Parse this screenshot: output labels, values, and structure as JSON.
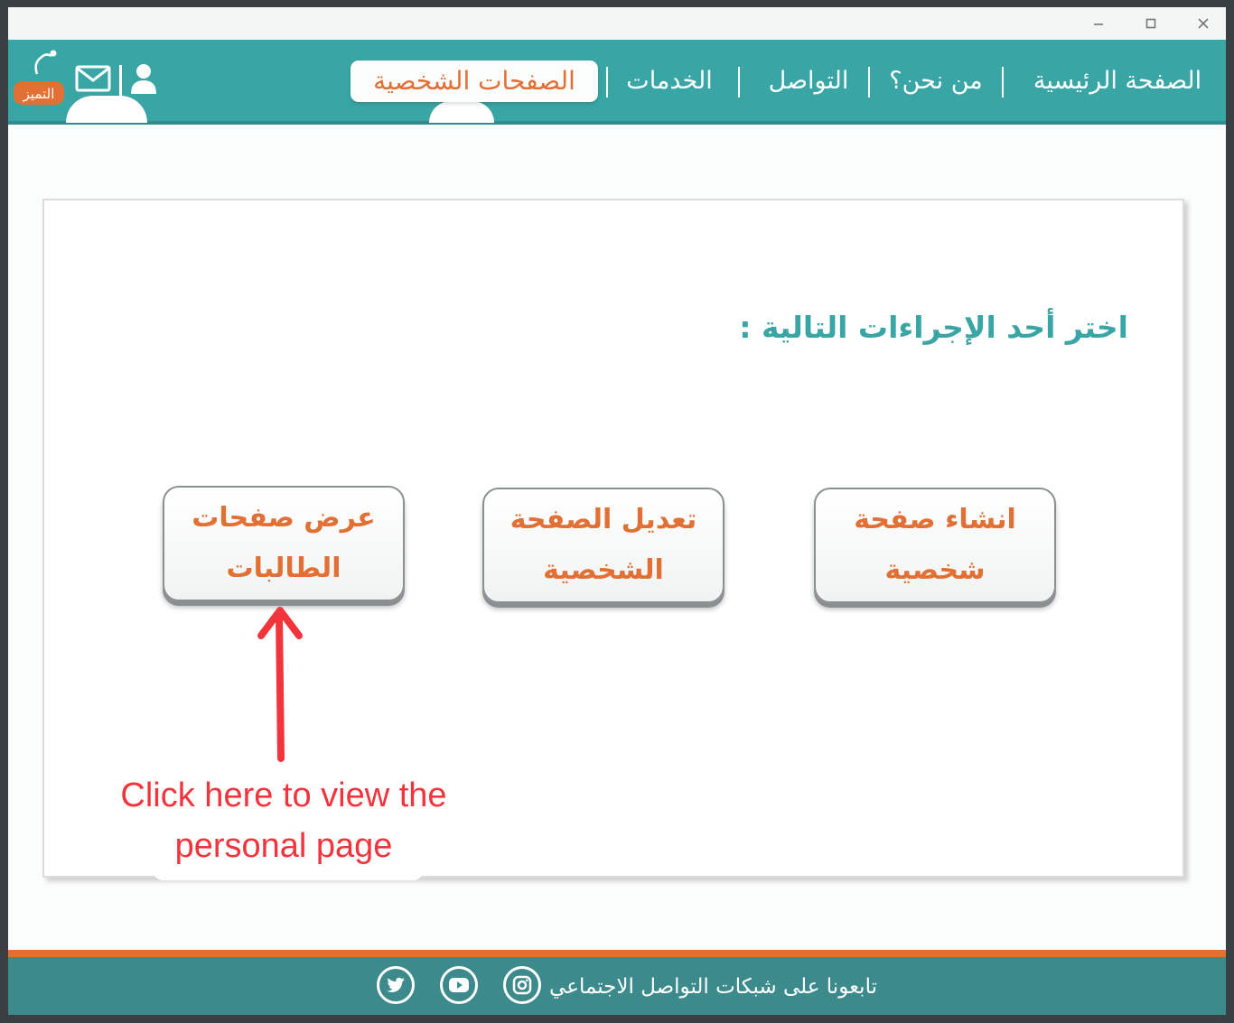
{
  "window": {
    "controls": {
      "minimize_icon": "minimize-icon",
      "maximize_icon": "maximize-icon",
      "close_icon": "close-icon"
    }
  },
  "nav": {
    "items": [
      "الصفحة الرئيسية",
      "من نحن؟",
      "التواصل",
      "الخدمات"
    ],
    "active": "الصفحات الشخصية",
    "logo_text": "التميز"
  },
  "main": {
    "prompt": "اختر أحد الإجراءات التالية :",
    "buttons": [
      {
        "line1": "انشاء صفحة",
        "line2": "شخصية"
      },
      {
        "line1": "تعديل الصفحة",
        "line2": "الشخصية"
      },
      {
        "line1": "عرض صفحات",
        "line2": "الطالبات"
      }
    ]
  },
  "annotation": {
    "line1": "Click here to view the",
    "line2": "personal page",
    "color": "#f2343c"
  },
  "footer": {
    "text": "تابعونا على شبكات التواصل الاجتماعي",
    "social_icons": [
      "instagram-icon",
      "youtube-icon",
      "twitter-icon"
    ]
  },
  "colors": {
    "teal": "#3aa5a5",
    "orange": "#e27035",
    "footer_teal": "#3d8a8c"
  }
}
